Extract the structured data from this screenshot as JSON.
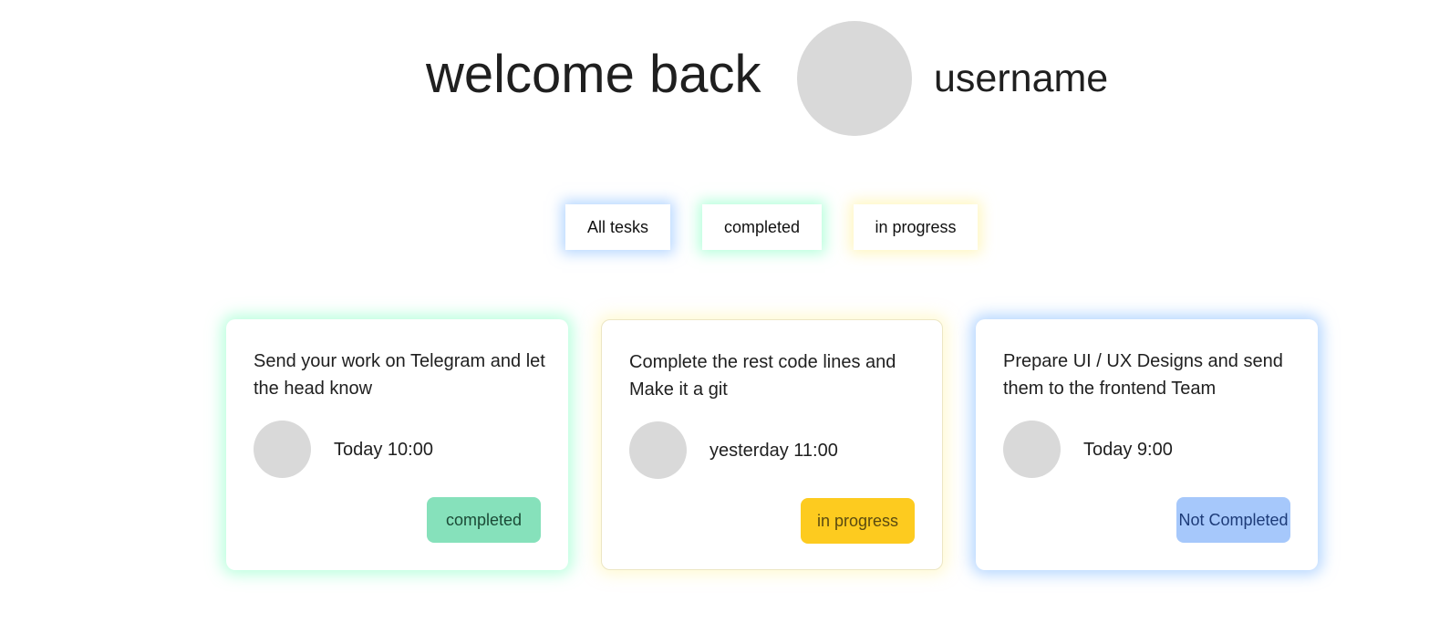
{
  "header": {
    "welcome_text": "welcome back",
    "username": "username"
  },
  "filters": {
    "all": "All tesks",
    "completed": "completed",
    "in_progress": "in progress"
  },
  "cards": [
    {
      "title": "Send your work on Telegram and let the head know",
      "time": "Today 10:00",
      "status": "completed"
    },
    {
      "title": "Complete the rest code lines and Make it a git",
      "time": "yesterday 11:00",
      "status": "in progress"
    },
    {
      "title": "Prepare UI / UX Designs and send them to the frontend Team",
      "time": "Today 9:00",
      "status": "Not Completed"
    }
  ],
  "colors": {
    "completed": "#86e1bb",
    "in_progress": "#fdcb1f",
    "not_completed": "#a6c8fb",
    "avatar_placeholder": "#d9d9d9"
  }
}
